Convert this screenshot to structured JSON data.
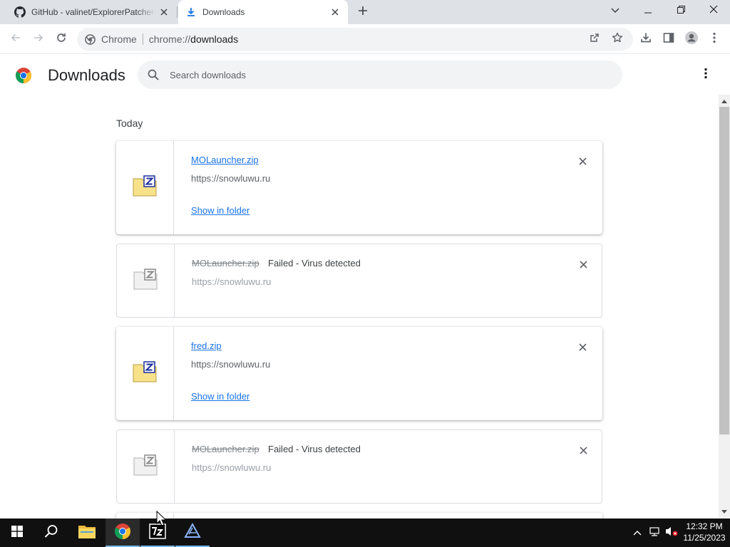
{
  "tabs": [
    {
      "title": "GitHub - valinet/ExplorerPatcher",
      "active": false
    },
    {
      "title": "Downloads",
      "active": true
    }
  ],
  "omnibox": {
    "chip": "Chrome",
    "scheme": "chrome://",
    "host": "downloads"
  },
  "page": {
    "title": "Downloads",
    "search_placeholder": "Search downloads"
  },
  "section": "Today",
  "downloads": [
    {
      "name": "MOLauncher.zip",
      "url": "https://snowluwu.ru",
      "status": "",
      "action": "Show in folder",
      "failed": false
    },
    {
      "name": "MOLauncher.zip",
      "url": "https://snowluwu.ru",
      "status": "Failed - Virus detected",
      "action": "",
      "failed": true
    },
    {
      "name": "fred.zip",
      "url": "https://snowluwu.ru",
      "status": "",
      "action": "Show in folder",
      "failed": false
    },
    {
      "name": "MOLauncher.zip",
      "url": "https://snowluwu.ru",
      "status": "Failed - Virus detected",
      "action": "",
      "failed": true
    }
  ],
  "taskbar": {
    "time": "12:32 PM",
    "date": "11/25/2023"
  },
  "colors": {
    "accent": "#1a73e8",
    "tabstrip": "#dee1e6",
    "taskbar": "#101010"
  }
}
